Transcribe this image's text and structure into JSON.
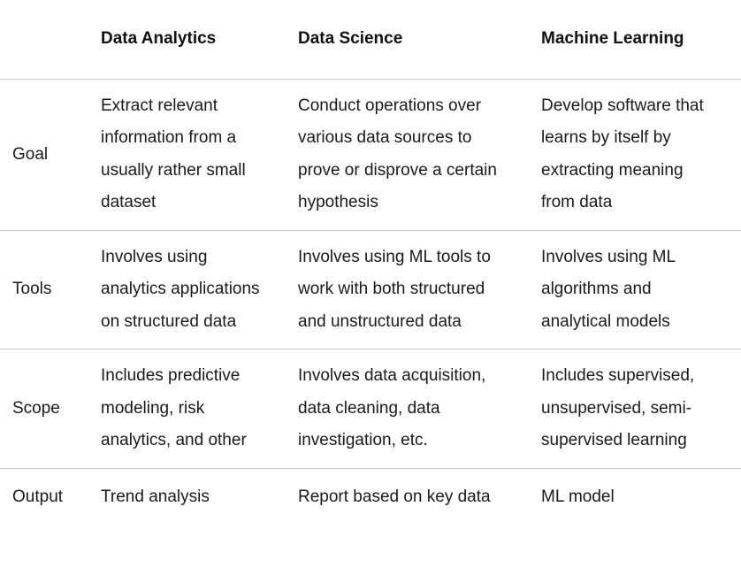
{
  "table": {
    "corner_label": "",
    "columns": [
      {
        "key": "data_analytics",
        "label": "Data Analytics"
      },
      {
        "key": "data_science",
        "label": "Data Science"
      },
      {
        "key": "machine_learning",
        "label": "Machine Learning"
      }
    ],
    "rows": [
      {
        "label": "Goal",
        "cells": [
          "Extract relevant information from a usually rather small dataset",
          "Conduct operations over various data sources to prove or disprove a certain hypothesis",
          "Develop software that learns by itself by extracting meaning from data"
        ]
      },
      {
        "label": "Tools",
        "cells": [
          "Involves using analytics applications on structured data",
          "Involves using ML tools to work with both structured and unstructured data",
          "Involves using ML algorithms and analytical models"
        ]
      },
      {
        "label": "Scope",
        "cells": [
          "Includes predictive modeling, risk analytics, and other",
          "Involves data acquisition, data cleaning, data investigation, etc.",
          "Includes supervised, unsupervised, semi-supervised learning"
        ]
      },
      {
        "label": "Output",
        "cells": [
          "Trend analysis",
          "Report based on key data",
          "ML model"
        ]
      }
    ]
  },
  "style": {
    "text_color": "#1a1a1a",
    "header_color": "#111111",
    "divider_color": "#c8c8c8",
    "background": "#ffffff"
  }
}
